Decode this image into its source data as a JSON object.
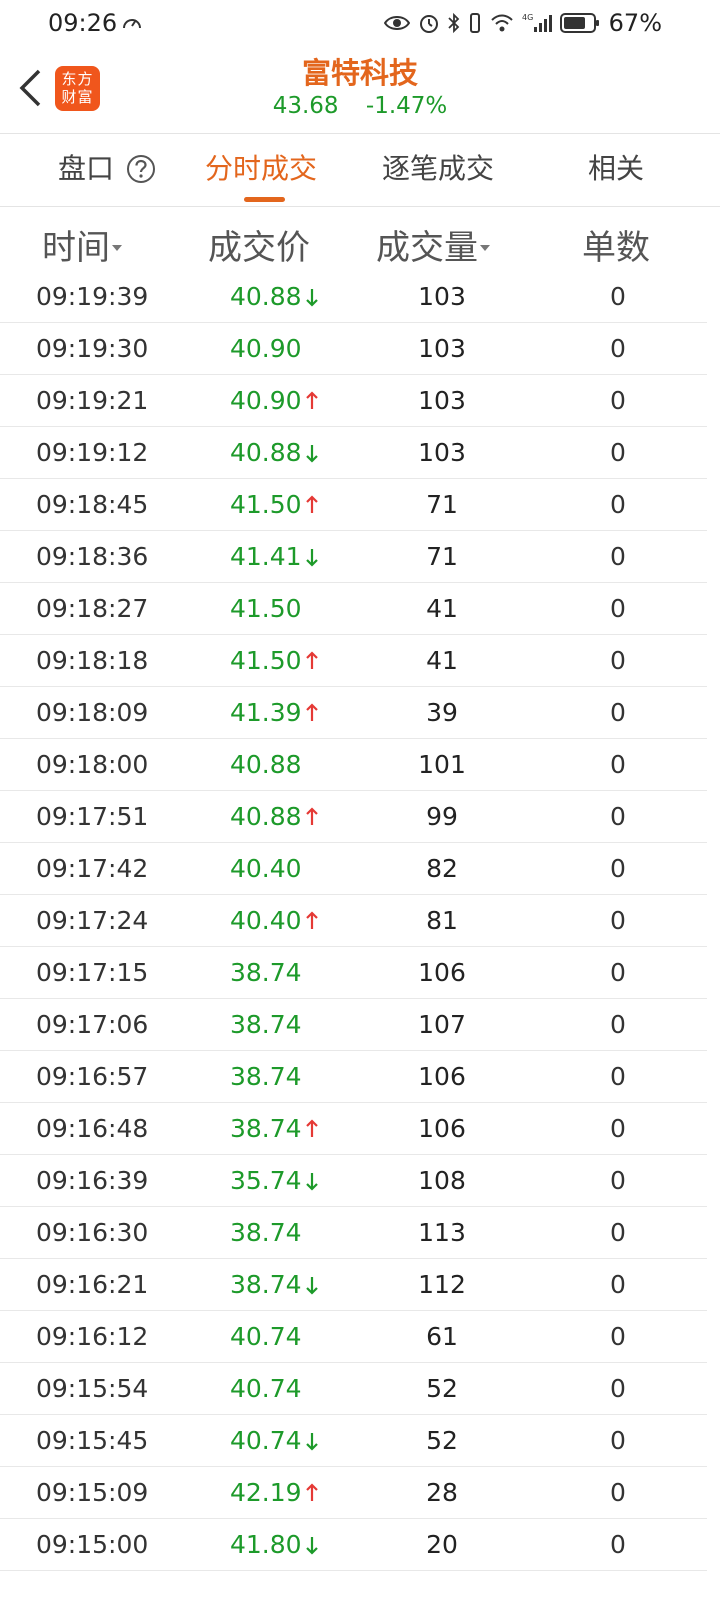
{
  "status": {
    "time": "09:26",
    "battery_pct": "67%",
    "network": "4G"
  },
  "header": {
    "logo_line1": "东方",
    "logo_line2": "财富",
    "stock_name": "富特科技",
    "price": "43.68",
    "change_pct": "-1.47%"
  },
  "tabs": [
    {
      "label": "盘口"
    },
    {
      "label": "分时成交"
    },
    {
      "label": "逐笔成交"
    },
    {
      "label": "相关"
    }
  ],
  "columns": {
    "time": "时间",
    "price": "成交价",
    "volume": "成交量",
    "count": "单数"
  },
  "colors": {
    "accent": "#e3661d",
    "down_green": "#1d9a2a",
    "up_red": "#e53935"
  },
  "rows": [
    {
      "time": "09:19:39",
      "price": "40.88",
      "dir": "down",
      "volume": "103",
      "count": "0"
    },
    {
      "time": "09:19:30",
      "price": "40.90",
      "dir": "",
      "volume": "103",
      "count": "0"
    },
    {
      "time": "09:19:21",
      "price": "40.90",
      "dir": "up",
      "volume": "103",
      "count": "0"
    },
    {
      "time": "09:19:12",
      "price": "40.88",
      "dir": "down",
      "volume": "103",
      "count": "0"
    },
    {
      "time": "09:18:45",
      "price": "41.50",
      "dir": "up",
      "volume": "71",
      "count": "0"
    },
    {
      "time": "09:18:36",
      "price": "41.41",
      "dir": "down",
      "volume": "71",
      "count": "0"
    },
    {
      "time": "09:18:27",
      "price": "41.50",
      "dir": "",
      "volume": "41",
      "count": "0"
    },
    {
      "time": "09:18:18",
      "price": "41.50",
      "dir": "up",
      "volume": "41",
      "count": "0"
    },
    {
      "time": "09:18:09",
      "price": "41.39",
      "dir": "up",
      "volume": "39",
      "count": "0"
    },
    {
      "time": "09:18:00",
      "price": "40.88",
      "dir": "",
      "volume": "101",
      "count": "0"
    },
    {
      "time": "09:17:51",
      "price": "40.88",
      "dir": "up",
      "volume": "99",
      "count": "0"
    },
    {
      "time": "09:17:42",
      "price": "40.40",
      "dir": "",
      "volume": "82",
      "count": "0"
    },
    {
      "time": "09:17:24",
      "price": "40.40",
      "dir": "up",
      "volume": "81",
      "count": "0"
    },
    {
      "time": "09:17:15",
      "price": "38.74",
      "dir": "",
      "volume": "106",
      "count": "0"
    },
    {
      "time": "09:17:06",
      "price": "38.74",
      "dir": "",
      "volume": "107",
      "count": "0"
    },
    {
      "time": "09:16:57",
      "price": "38.74",
      "dir": "",
      "volume": "106",
      "count": "0"
    },
    {
      "time": "09:16:48",
      "price": "38.74",
      "dir": "up",
      "volume": "106",
      "count": "0"
    },
    {
      "time": "09:16:39",
      "price": "35.74",
      "dir": "down",
      "volume": "108",
      "count": "0"
    },
    {
      "time": "09:16:30",
      "price": "38.74",
      "dir": "",
      "volume": "113",
      "count": "0"
    },
    {
      "time": "09:16:21",
      "price": "38.74",
      "dir": "down",
      "volume": "112",
      "count": "0"
    },
    {
      "time": "09:16:12",
      "price": "40.74",
      "dir": "",
      "volume": "61",
      "count": "0"
    },
    {
      "time": "09:15:54",
      "price": "40.74",
      "dir": "",
      "volume": "52",
      "count": "0"
    },
    {
      "time": "09:15:45",
      "price": "40.74",
      "dir": "down",
      "volume": "52",
      "count": "0"
    },
    {
      "time": "09:15:09",
      "price": "42.19",
      "dir": "up",
      "volume": "28",
      "count": "0"
    },
    {
      "time": "09:15:00",
      "price": "41.80",
      "dir": "down",
      "volume": "20",
      "count": "0"
    }
  ]
}
